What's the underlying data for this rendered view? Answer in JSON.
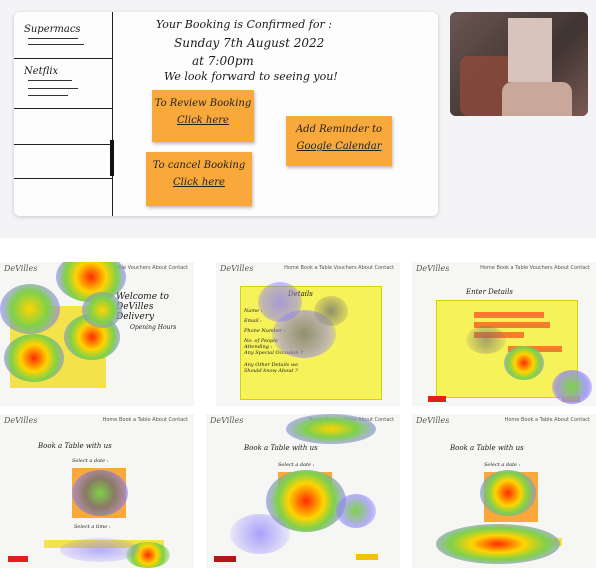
{
  "sketch": {
    "sidebar_items": [
      {
        "label": "Supermacs"
      },
      {
        "label": "Netflix"
      }
    ],
    "message": {
      "line1": "Your Booking is Confirmed for :",
      "line2": "Sunday 7th August 2022",
      "line3": "at 7:00pm",
      "line4": "We look forward to seeing you!"
    },
    "review_note": {
      "line1": "To Review Booking",
      "line2": "Click here"
    },
    "cancel_note": {
      "line1": "To cancel Booking",
      "line2": "Click here"
    },
    "reminder_note": {
      "line1": "Add Reminder to",
      "line2": "Google Calendar"
    }
  },
  "heatmaps": [
    {
      "logo": "DeVilles",
      "nav": "Home  Book a Table  Vouchers  About  Contact"
    },
    {
      "logo": "DeVilles",
      "nav": "Home  Book a Table  Vouchers  About  Contact"
    },
    {
      "logo": "DeVilles",
      "nav": "Home  Book a Table  Vouchers  About  Contact"
    },
    {
      "logo": "DeVilles",
      "nav": "Home  Book a Table  About  Contact"
    },
    {
      "logo": "DeVilles",
      "nav": "Home  Book a Table  About  Contact"
    },
    {
      "logo": "DeVilles",
      "nav": "Home  Book a Table  About  Contact"
    }
  ],
  "heat_texts": {
    "welcome": "Welcome to DeVilles Delivery",
    "opening": "Opening Hours",
    "details_title": "Details",
    "enter_details": "Enter Details",
    "book_title": "Book a Table with us",
    "select_date": "Select a date :",
    "select_time": "Select a time :",
    "name": "Name :",
    "email": "Email :",
    "phone": "Phone Number :",
    "people": "No. of People Attending :",
    "special": "Any Special Occasion ?",
    "other": "Any Other Details we Should know About ?"
  },
  "colors": {
    "sticky": "#f9a93b",
    "sheet": "#f6f25a",
    "heat_hot": "#ff2a00",
    "heat_mid": "#ffd400",
    "heat_cool": "#7fd14a",
    "heat_edge": "#8a7cff"
  }
}
